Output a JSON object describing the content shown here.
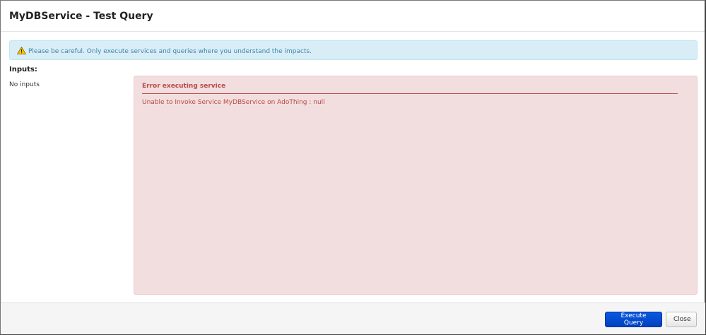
{
  "dialog": {
    "title": "MyDBService - Test Query"
  },
  "alert": {
    "icon": "warning-icon",
    "text": "Please be careful. Only execute services and queries where you understand the impacts."
  },
  "inputs": {
    "label": "Inputs:",
    "empty_text": "No inputs"
  },
  "error": {
    "title": "Error executing service",
    "message": "Unable to Invoke Service MyDBService on AdoThing : null"
  },
  "footer": {
    "execute_label": "Execute Query",
    "close_label": "Close"
  },
  "colors": {
    "primary": "#0044cc",
    "error_bg": "#f2dede",
    "error_text": "#b94a48",
    "info_bg": "#d9edf7"
  }
}
